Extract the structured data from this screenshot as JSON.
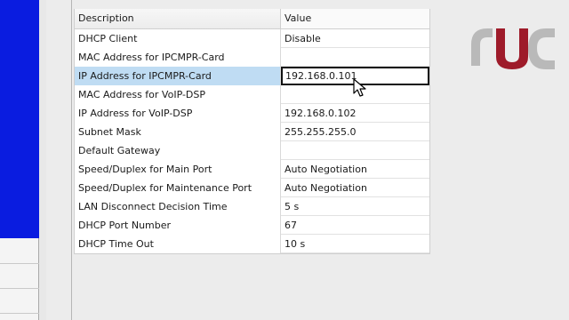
{
  "table": {
    "headers": {
      "description": "Description",
      "value": "Value"
    },
    "rows": [
      {
        "description": "DHCP Client",
        "value": "Disable"
      },
      {
        "description": "MAC Address for IPCMPR-Card",
        "value": ""
      },
      {
        "description": "IP Address for IPCMPR-Card",
        "value": "192.168.0.101"
      },
      {
        "description": "MAC Address for VoIP-DSP",
        "value": ""
      },
      {
        "description": "IP Address for VoIP-DSP",
        "value": "192.168.0.102"
      },
      {
        "description": "Subnet Mask",
        "value": "255.255.255.0"
      },
      {
        "description": "Default Gateway",
        "value": ""
      },
      {
        "description": "Speed/Duplex for Main Port",
        "value": "Auto Negotiation"
      },
      {
        "description": "Speed/Duplex for Maintenance Port",
        "value": "Auto Negotiation"
      },
      {
        "description": "LAN Disconnect Decision Time",
        "value": "5 s"
      },
      {
        "description": "DHCP Port Number",
        "value": "67"
      },
      {
        "description": "DHCP Time Out",
        "value": "10 s"
      }
    ]
  },
  "selected_row": "IP Address for IPCMPR-Card",
  "logo": {
    "name": "watermark-logo",
    "colors": [
      "#9e1b2a",
      "#b9b9b9"
    ]
  },
  "colors": {
    "selection": "#bfdcf3",
    "left_panel": "#0a1ce0"
  },
  "icons": {
    "cursor": "mouse-pointer-icon"
  }
}
